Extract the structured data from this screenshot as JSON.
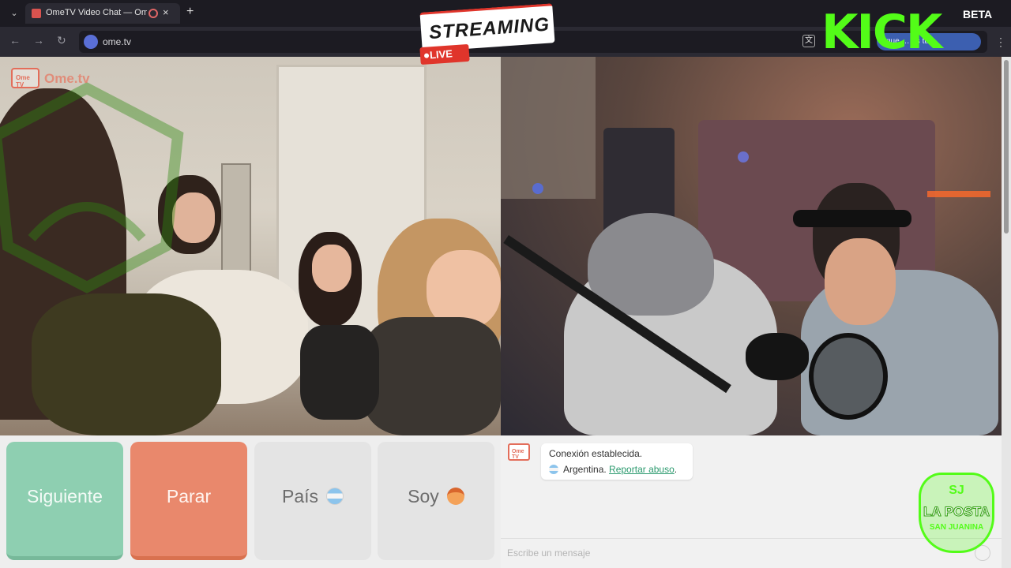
{
  "browser": {
    "tab_title": "OmeTV Video Chat — Ome",
    "tab_close": "×",
    "new_tab": "+",
    "tab_menu": "⌄",
    "nav_back": "←",
    "nav_forward": "→",
    "nav_reload": "↻",
    "url": "ome.tv",
    "extension_text": "que … es tu",
    "menu": "⋮",
    "translate_icon": "文"
  },
  "overlay": {
    "streaming": "STREAMING",
    "live": "LIVE",
    "kick": "KICK",
    "beta": "BETA",
    "channel_logo_line1": "SJ",
    "channel_logo_line2": "LA POSTA",
    "channel_logo_line3": "SAN JUANINA",
    "brand_color": "#53fc18"
  },
  "video": {
    "watermark": "Ome.tv",
    "watermark_box": "Ome TV"
  },
  "controls": {
    "next_label": "Siguiente",
    "stop_label": "Parar",
    "country_label": "País",
    "gender_label": "Soy",
    "next_color": "#8ecfb1",
    "stop_color": "#e9886c"
  },
  "chat": {
    "logo": "Ome TV",
    "connection_status": "Conexión establecida.",
    "country": "Argentina.",
    "report_link": "Reportar abuso",
    "report_suffix": ".",
    "input_placeholder": "Escribe un mensaje"
  }
}
